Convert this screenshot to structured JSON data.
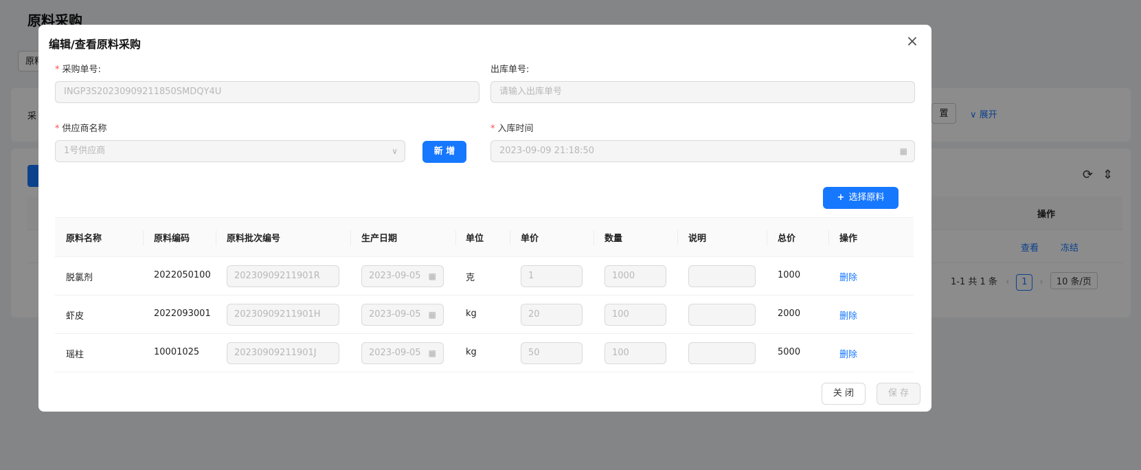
{
  "background": {
    "page_title": "原料采购",
    "tab_label": "原料",
    "filter_label": "采",
    "reset_label": "置",
    "expand_label": "展开",
    "table_op_header": "操作",
    "row_view": "查看",
    "row_freeze": "冻结",
    "pager_total": "1-1 共 1 条",
    "pager_current": "1",
    "pager_size": "10 条/页"
  },
  "modal": {
    "title": "编辑/查看原料采购",
    "close_icon": "close-icon",
    "fields": {
      "purchase_no_label": "采购单号:",
      "purchase_no_value": "INGP3S20230909211850SMDQY4U",
      "outbound_no_label": "出库单号:",
      "outbound_no_placeholder": "请输入出库单号",
      "supplier_label": "供应商名称",
      "supplier_value": "1号供应商",
      "add_button": "新 增",
      "inbound_time_label": "入库时间",
      "inbound_time_value": "2023-09-09 21:18:50"
    },
    "select_material_button": "选择原料",
    "table": {
      "headers": [
        "原料名称",
        "原料编码",
        "原料批次编号",
        "生产日期",
        "单位",
        "单价",
        "数量",
        "说明",
        "总价",
        "操作"
      ],
      "rows": [
        {
          "name": "脱氯剂",
          "code": "2022050100",
          "batch": "20230909211901R",
          "date": "2023-09-05",
          "unit": "克",
          "price": "1",
          "qty": "1000",
          "note": "",
          "total": "1000",
          "action": "删除"
        },
        {
          "name": "虾皮",
          "code": "2022093001",
          "batch": "20230909211901H",
          "date": "2023-09-05",
          "unit": "kg",
          "price": "20",
          "qty": "100",
          "note": "",
          "total": "2000",
          "action": "删除"
        },
        {
          "name": "瑶柱",
          "code": "10001025",
          "batch": "20230909211901J",
          "date": "2023-09-05",
          "unit": "kg",
          "price": "50",
          "qty": "100",
          "note": "",
          "total": "5000",
          "action": "删除"
        }
      ]
    },
    "footer": {
      "close_button": "关 闭",
      "save_button": "保 存"
    }
  },
  "colors": {
    "primary": "#1677ff",
    "required": "#ff4d4f",
    "mask": "rgba(0,0,0,0.45)"
  }
}
